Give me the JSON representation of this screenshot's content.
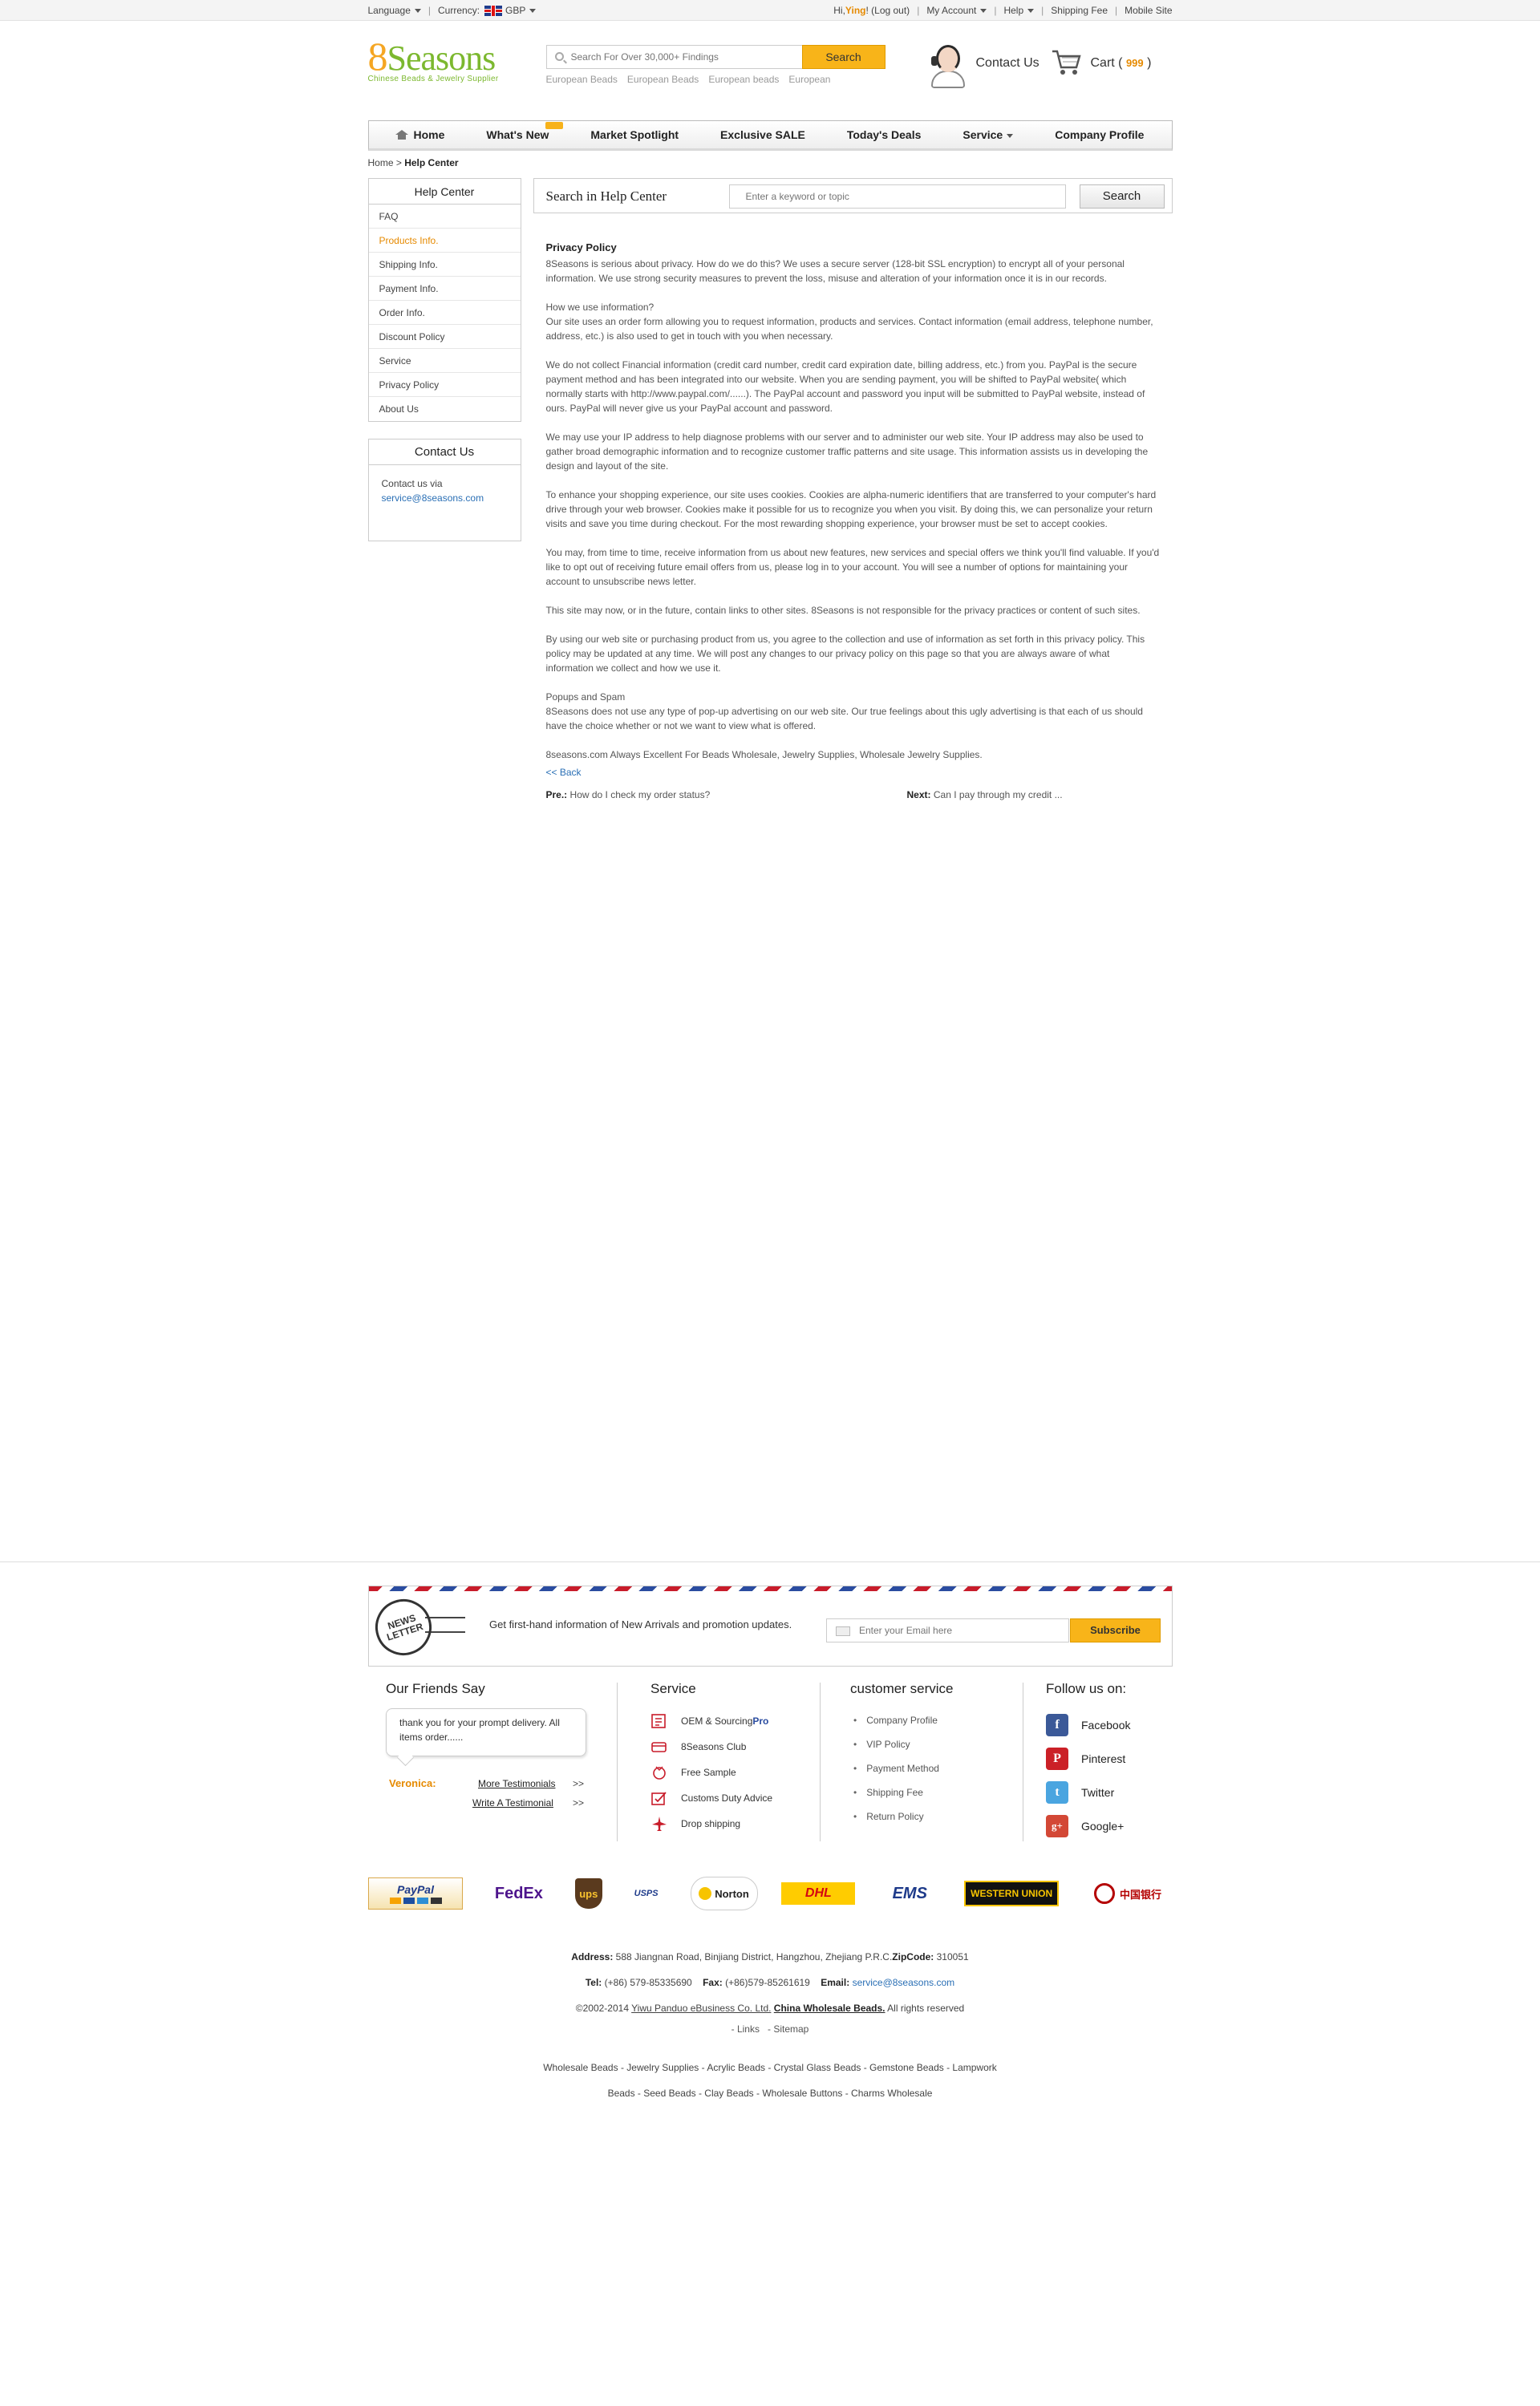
{
  "topbar": {
    "language": "Language",
    "currency_label": "Currency:",
    "currency_value": "GBP",
    "greeting": "Hi, ",
    "username": "Ying",
    "logout": "! (Log out)",
    "my_account": "My Account",
    "help": "Help",
    "shipping_fee": "Shipping Fee",
    "mobile_site": "Mobile Site"
  },
  "header": {
    "logo_text": "Seasons",
    "logo_eight": "8",
    "logo_tagline": "Chinese Beads & Jewelry Supplier",
    "search_placeholder": "Search For Over 30,000+ Findings",
    "search_button": "Search",
    "hot_searches": [
      "European Beads",
      "European Beads",
      "European beads",
      "European"
    ],
    "contact_us": "Contact Us",
    "cart_label": "Cart",
    "cart_count_open": " ( ",
    "cart_count": "999",
    "cart_count_close": " )"
  },
  "nav": {
    "items": [
      "Home",
      "What's New",
      "Market Spotlight",
      "Exclusive SALE",
      "Today's Deals",
      "Service",
      "Company Profile"
    ]
  },
  "breadcrumb": {
    "home": "Home",
    "separator": " > ",
    "current": "Help Center"
  },
  "sidebar": {
    "title": "Help Center",
    "items": [
      "FAQ",
      "Products Info.",
      "Shipping Info.",
      "Payment Info.",
      "Order Info.",
      "Discount Policy",
      "Service",
      "Privacy Policy",
      "About Us"
    ],
    "active_item": "Products Info.",
    "contact_title": "Contact Us",
    "contact_text": "Contact us via",
    "contact_email": "service@8seasons.com"
  },
  "main": {
    "search_title": "Search in Help Center",
    "search_placeholder": "Enter a keyword or topic",
    "search_button": "Search",
    "article_title": "Privacy Policy",
    "paragraphs": [
      "8Seasons is serious about privacy. How do we do this? We uses a secure server (128-bit SSL encryption) to encrypt all of your personal information. We use strong security measures to prevent the loss, misuse and alteration of your information once it is in our records.",
      "How we use information?\nOur site uses an order form allowing you to request information, products and services. Contact information (email address, telephone number, address, etc.) is also used to get in touch with you when necessary.",
      "We do not collect Financial information (credit card number, credit card expiration date, billing address, etc.) from you. PayPal is the secure payment method and has been integrated into our website. When you are sending payment, you will be shifted to PayPal website( which normally starts with http://www.paypal.com/......).  The PayPal account and password you input will be submitted to PayPal website, instead of ours. PayPal will never give us your PayPal account and password.",
      "We may use your IP address to help diagnose problems with our server and to administer our web site. Your IP address may also be used to gather broad demographic information and to recognize customer traffic patterns and site usage. This information assists us in developing the design and layout of the site.",
      "To enhance your shopping experience, our site uses cookies. Cookies are alpha-numeric identifiers that are transferred to your computer's hard drive through your web browser. Cookies make it possible for us to recognize you when you visit. By doing this, we can personalize your return visits and save you time during checkout. For the most rewarding shopping experience, your browser must be set to accept cookies.",
      "You may, from time to time, receive information from us about new features, new services and special offers we think you'll find valuable. If you'd like to opt out of receiving future email offers from us, please log in to your account. You will see a number of options for maintaining your account to unsubscribe news letter.",
      "This site may now, or in the future, contain links to other sites. 8Seasons is not responsible for the privacy practices or content of such sites.",
      "By using our web site or purchasing product from us, you agree to the collection and use of information as set forth in this privacy policy. This policy may be updated at any time. We will post any changes to our privacy policy on this page so that you are always aware of what information we collect and how we use it.",
      "Popups and Spam\n8Seasons does not use any type of pop-up advertising on our web site. Our true feelings about this ugly advertising is that each of us should have the choice whether or not we want to view what is offered.",
      "8seasons.com Always Excellent For  Beads Wholesale, Jewelry Supplies, Wholesale Jewelry Supplies."
    ],
    "back_link": "<< Back",
    "pre_label": "Pre.:",
    "pre_text": " How do I check my order status?",
    "next_label": "Next:",
    "next_text": " Can I pay through my credit ..."
  },
  "newsletter": {
    "stamp_text": "NEWS LETTER",
    "text": "Get first-hand information of New Arrivals and promotion updates.",
    "placeholder": "Enter your Email here",
    "button": "Subscribe"
  },
  "footer": {
    "friends_title": "Our Friends Say",
    "testimonial": "thank you for your prompt delivery. All items order......",
    "testimonial_author": "Veronica:",
    "more_testimonials": "More Testimonials",
    "write_testimonial": "Write A Testimonial",
    "arrows": ">>",
    "service_title": "Service",
    "service_items": [
      {
        "label": "OEM & Sourcing ",
        "extra": "Pro",
        "icon": "oem-icon"
      },
      {
        "label": "8Seasons Club",
        "extra": "",
        "icon": "club-card-icon"
      },
      {
        "label": "Free Sample",
        "extra": "",
        "icon": "sample-icon"
      },
      {
        "label": "Customs Duty Advice",
        "extra": "",
        "icon": "customs-icon"
      },
      {
        "label": "Drop shipping",
        "extra": "",
        "icon": "airplane-icon"
      }
    ],
    "cs_title": "customer service",
    "cs_items": [
      "Company Profile",
      "VIP Policy",
      "Payment Method",
      "Shipping Fee",
      "Return Policy"
    ],
    "follow_title": "Follow us on:",
    "social": [
      {
        "label": "Facebook",
        "icon": "facebook-icon",
        "color": "#3b5998",
        "glyph": "f"
      },
      {
        "label": "Pinterest",
        "icon": "pinterest-icon",
        "color": "#cb2027",
        "glyph": "P"
      },
      {
        "label": "Twitter",
        "icon": "twitter-icon",
        "color": "#4aa5e0",
        "glyph": "t"
      },
      {
        "label": "Google+",
        "icon": "google-plus-icon",
        "color": "#d34836",
        "glyph": "g+"
      }
    ],
    "payments": [
      "PayPal",
      "FedEx",
      "ups",
      "USPS",
      "Norton",
      "DHL",
      "EMS",
      "WESTERN UNION",
      "中国银行"
    ],
    "address_label": "Address:",
    "address": " 588 Jiangnan Road, Binjiang District, Hangzhou, Zhejiang P.R.C.",
    "zip_label": "ZipCode:",
    "zip": " 310051",
    "tel_label": "Tel:",
    "tel": " (+86) 579-85335690",
    "fax_label": "Fax:",
    "fax": " (+86)579-85261619",
    "email_label": "Email:",
    "email": "service@8seasons.com",
    "copyright": "©2002-2014 ",
    "company": "Yiwu Panduo eBusiness Co. Ltd.",
    "brand": "China Wholesale Beads.",
    "rights": " All rights reserved",
    "links": "- Links",
    "sitemap": "- Sitemap",
    "keywords_line1": "Wholesale Beads - Jewelry Supplies - Acrylic Beads - Crystal Glass Beads - Gemstone Beads - Lampwork",
    "keywords_line2": "Beads - Seed Beads - Clay Beads - Wholesale Buttons - Charms Wholesale"
  }
}
